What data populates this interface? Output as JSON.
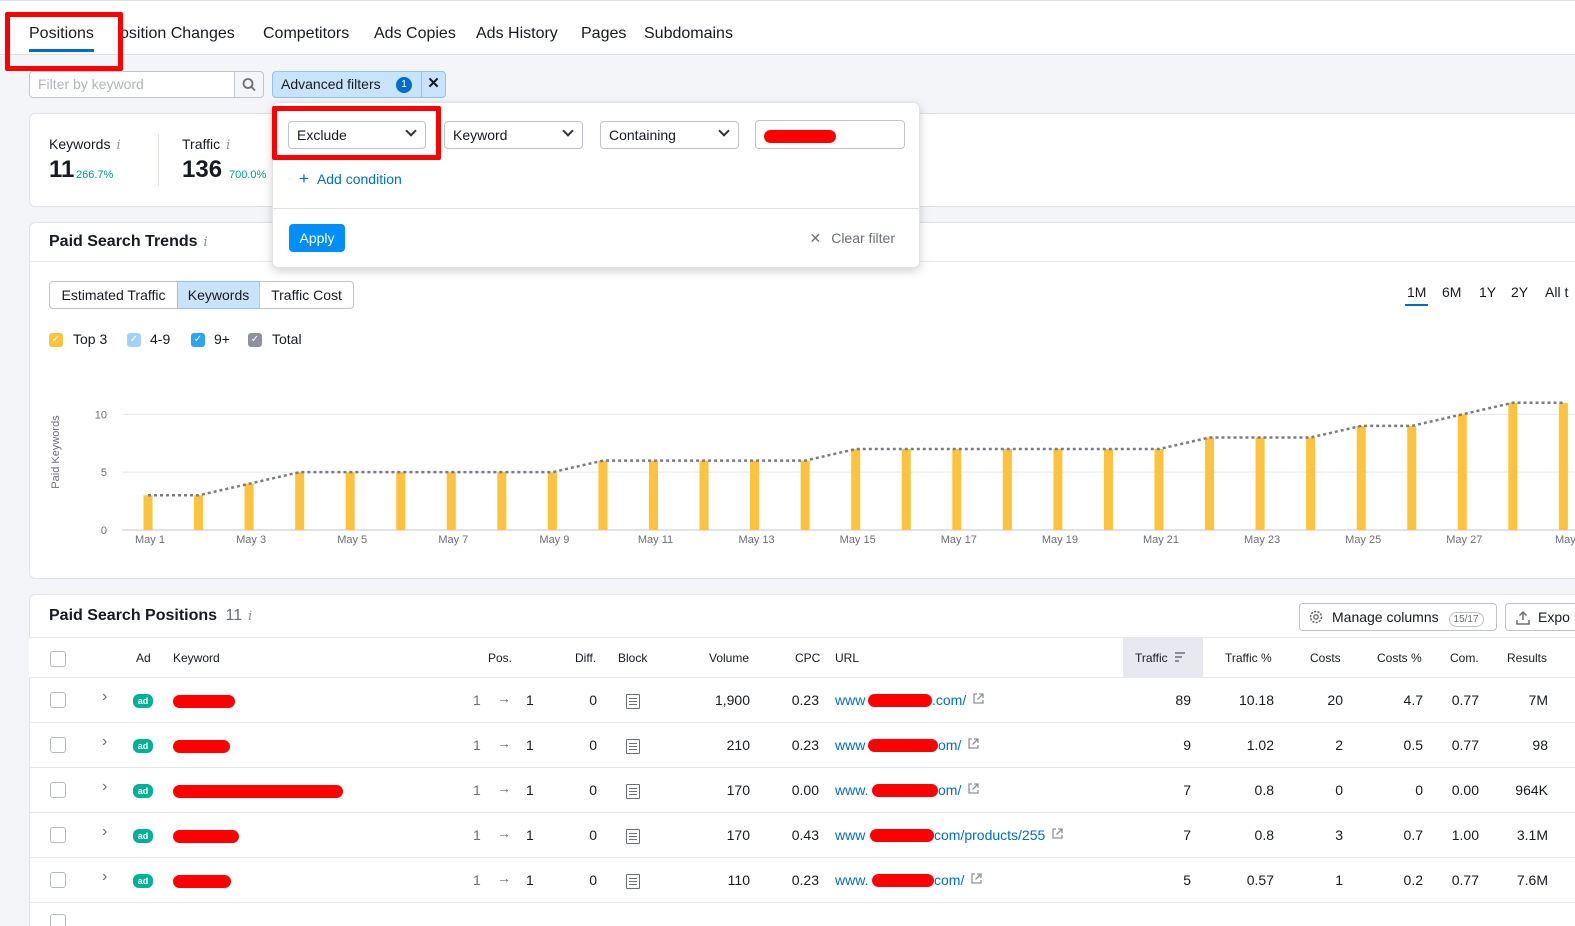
{
  "tabs": [
    "Positions",
    "osition Changes",
    "Competitors",
    "Ads Copies",
    "Ads History",
    "Pages",
    "Subdomains"
  ],
  "filter": {
    "placeholder": "Filter by keyword",
    "advanced_label": "Advanced filters",
    "advanced_count": "1"
  },
  "kpis": {
    "keywords": {
      "label": "Keywords",
      "value": "11",
      "change": "266.7%"
    },
    "traffic": {
      "label": "Traffic",
      "value": "136",
      "change": "700.0%"
    }
  },
  "popup": {
    "mode": "Exclude",
    "field": "Keyword",
    "operator": "Containing",
    "add_condition": "Add condition",
    "apply": "Apply",
    "clear": "Clear filter"
  },
  "trends": {
    "title": "Paid Search Trends",
    "segments": [
      "Estimated Traffic",
      "Keywords",
      "Traffic Cost"
    ],
    "periods": [
      "1M",
      "6M",
      "1Y",
      "2Y",
      "All t"
    ],
    "legend": [
      "Top 3",
      "4-9",
      "9+",
      "Total"
    ]
  },
  "chart_data": {
    "type": "bar",
    "ylabel": "Paid Keywords",
    "ylim": [
      0,
      10
    ],
    "yticks": [
      0,
      5,
      10
    ],
    "x_tick_labels": [
      "May 1",
      "May 3",
      "May 5",
      "May 7",
      "May 9",
      "May 11",
      "May 13",
      "May 15",
      "May 17",
      "May 19",
      "May 21",
      "May 23",
      "May 25",
      "May 27",
      "May"
    ],
    "categories": [
      "May 1",
      "May 2",
      "May 3",
      "May 4",
      "May 5",
      "May 6",
      "May 7",
      "May 8",
      "May 9",
      "May 10",
      "May 11",
      "May 12",
      "May 13",
      "May 14",
      "May 15",
      "May 16",
      "May 17",
      "May 18",
      "May 19",
      "May 20",
      "May 21",
      "May 22",
      "May 23",
      "May 24",
      "May 25",
      "May 26",
      "May 27",
      "May 28",
      "May 29"
    ],
    "series": [
      {
        "name": "Top 3",
        "color": "#fdc23e",
        "values": [
          3,
          3,
          4,
          5,
          5,
          5,
          5,
          5,
          5,
          6,
          6,
          6,
          6,
          6,
          7,
          7,
          7,
          7,
          7,
          7,
          7,
          8,
          8,
          8,
          9,
          9,
          10,
          11,
          11
        ]
      },
      {
        "name": "Total",
        "color": "#7a7c85",
        "style": "dotted",
        "values": [
          3,
          3,
          4,
          5,
          5,
          5,
          5,
          5,
          5,
          6,
          6,
          6,
          6,
          6,
          7,
          7,
          7,
          7,
          7,
          7,
          7,
          8,
          8,
          8,
          9,
          9,
          10,
          11,
          11
        ]
      }
    ]
  },
  "positions": {
    "title": "Paid Search Positions",
    "count": "11",
    "manage_columns": "Manage columns",
    "manage_badge": "15/17",
    "export": "Expo",
    "headers": [
      "Ad",
      "Keyword",
      "Pos.",
      "Diff.",
      "Block",
      "Volume",
      "CPC",
      "URL",
      "Traffic",
      "Traffic %",
      "Costs",
      "Costs %",
      "Com.",
      "Results"
    ],
    "rows": [
      {
        "pos_from": "1",
        "pos_to": "1",
        "diff": "0",
        "volume": "1,900",
        "cpc": "0.23",
        "url_pre": "www",
        "url_post": ".com/",
        "traffic": "89",
        "traffic_pct": "10.18",
        "costs": "20",
        "costs_pct": "4.7",
        "com": "0.77",
        "results": "7M"
      },
      {
        "pos_from": "1",
        "pos_to": "1",
        "diff": "0",
        "volume": "210",
        "cpc": "0.23",
        "url_pre": "www",
        "url_post": "om/",
        "traffic": "9",
        "traffic_pct": "1.02",
        "costs": "2",
        "costs_pct": "0.5",
        "com": "0.77",
        "results": "98"
      },
      {
        "pos_from": "1",
        "pos_to": "1",
        "diff": "0",
        "volume": "170",
        "cpc": "0.00",
        "url_pre": "www.",
        "url_post": "om/",
        "traffic": "7",
        "traffic_pct": "0.8",
        "costs": "0",
        "costs_pct": "0",
        "com": "0.00",
        "results": "964K"
      },
      {
        "pos_from": "1",
        "pos_to": "1",
        "diff": "0",
        "volume": "170",
        "cpc": "0.43",
        "url_pre": "www",
        "url_post": "com/products/255",
        "traffic": "7",
        "traffic_pct": "0.8",
        "costs": "3",
        "costs_pct": "0.7",
        "com": "1.00",
        "results": "3.1M"
      },
      {
        "pos_from": "1",
        "pos_to": "1",
        "diff": "0",
        "volume": "110",
        "cpc": "0.23",
        "url_pre": "www.",
        "url_post": "com/",
        "traffic": "5",
        "traffic_pct": "0.57",
        "costs": "1",
        "costs_pct": "0.2",
        "com": "0.77",
        "results": "7.6M"
      }
    ]
  }
}
